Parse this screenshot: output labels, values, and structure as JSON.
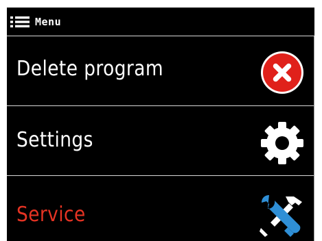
{
  "header": {
    "title": "Menu",
    "icon": "list-menu-icon"
  },
  "items": [
    {
      "label": "Delete program",
      "icon": "delete-x-icon",
      "label_color": "#ffffff",
      "icon_color": "#e0211b"
    },
    {
      "label": "Settings",
      "icon": "gear-icon",
      "label_color": "#ffffff",
      "icon_color": "#ffffff"
    },
    {
      "label": "Service",
      "icon": "wrench-hammer-icon",
      "label_color": "#e53323",
      "icon_colors": [
        "#ffffff",
        "#2f8fd6"
      ]
    }
  ],
  "colors": {
    "background": "#000000",
    "divider": "#d8d8d8",
    "accent_red": "#e0211b",
    "accent_blue": "#2f8fd6"
  }
}
